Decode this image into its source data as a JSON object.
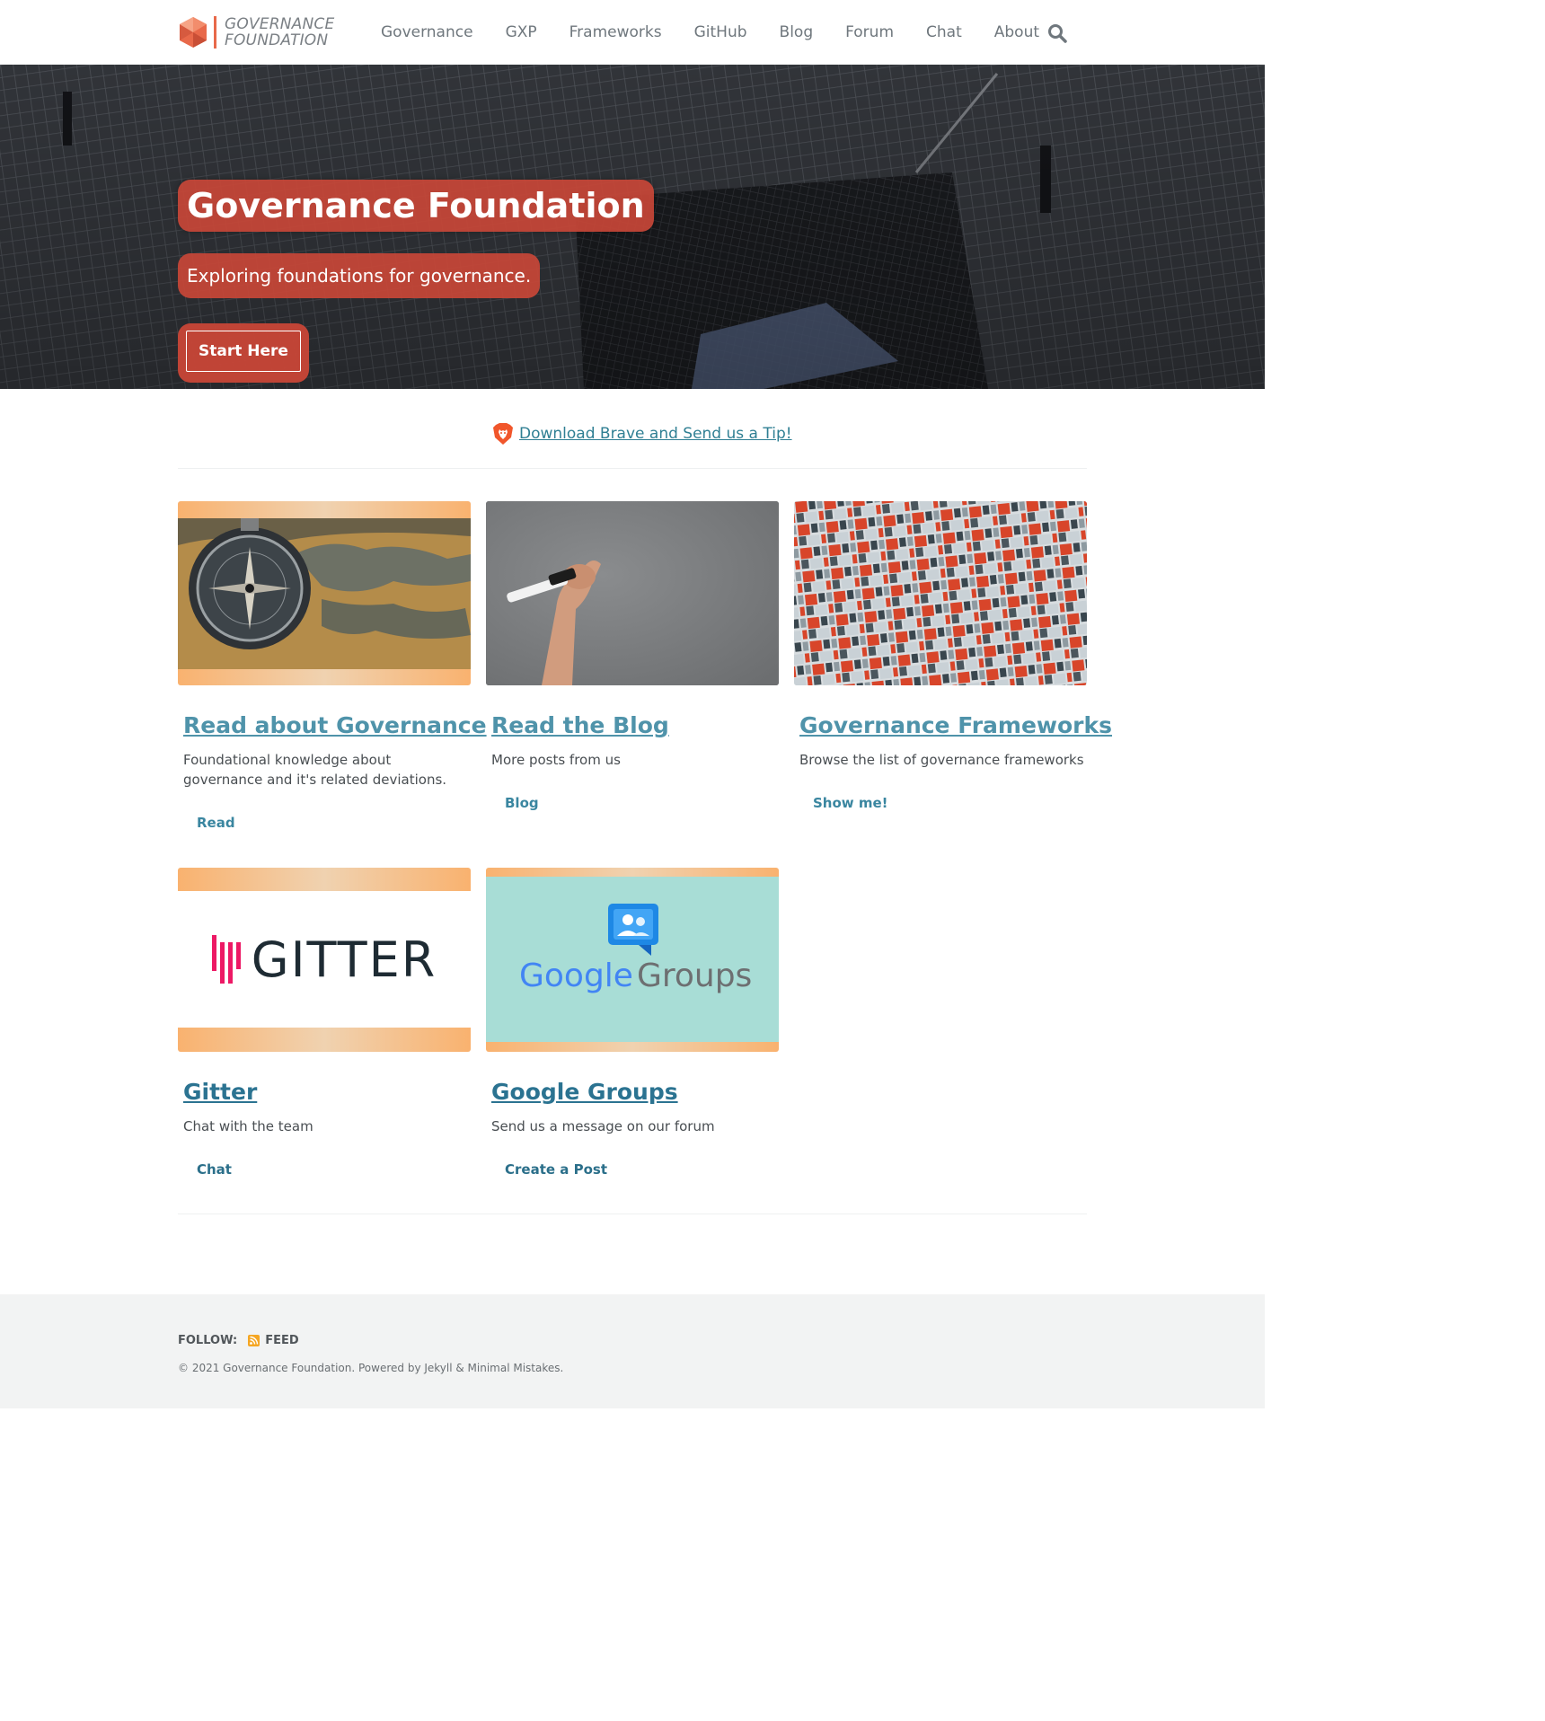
{
  "header": {
    "site_title_line1": "GOVERNANCE",
    "site_title_line2": "FOUNDATION",
    "nav": [
      "Governance",
      "GXP",
      "Frameworks",
      "GitHub",
      "Blog",
      "Forum",
      "Chat",
      "About"
    ],
    "search_icon": "search-icon"
  },
  "hero": {
    "title": "Governance Foundation",
    "excerpt": "Exploring foundations for governance.",
    "cta": "Start Here"
  },
  "tip": {
    "icon": "brave-lion-icon",
    "text": "Download Brave and Send us a Tip!"
  },
  "cards": [
    {
      "title": "Read about Governance",
      "excerpt": "Foundational knowledge about governance and it's related deviations.",
      "button": "Read",
      "image": "compass-on-map"
    },
    {
      "title": "Read the Blog",
      "excerpt": "More posts from us",
      "button": "Blog",
      "image": "hand-with-marker"
    },
    {
      "title": "Governance Frameworks",
      "excerpt": "Browse the list of governance frameworks",
      "button": "Show me!",
      "image": "apartment-facade"
    },
    {
      "title": "Gitter",
      "excerpt": "Chat with the team",
      "button": "Chat",
      "image": "gitter-logo",
      "logo_text": "GITTER"
    },
    {
      "title": "Google Groups",
      "excerpt": "Send us a message on our forum",
      "button": "Create a Post",
      "image": "google-groups-logo",
      "logo_google": "Google",
      "logo_groups": "Groups"
    }
  ],
  "footer": {
    "follow_label": "FOLLOW:",
    "feed_label": "FEED",
    "copyright": "© 2021 Governance Foundation. Powered by Jekyll & Minimal Mistakes."
  },
  "colors": {
    "accent": "#c84637",
    "link": "#4f93aa",
    "footer_bg": "#f2f3f3",
    "card_frame_orange": "#f9b26f"
  }
}
